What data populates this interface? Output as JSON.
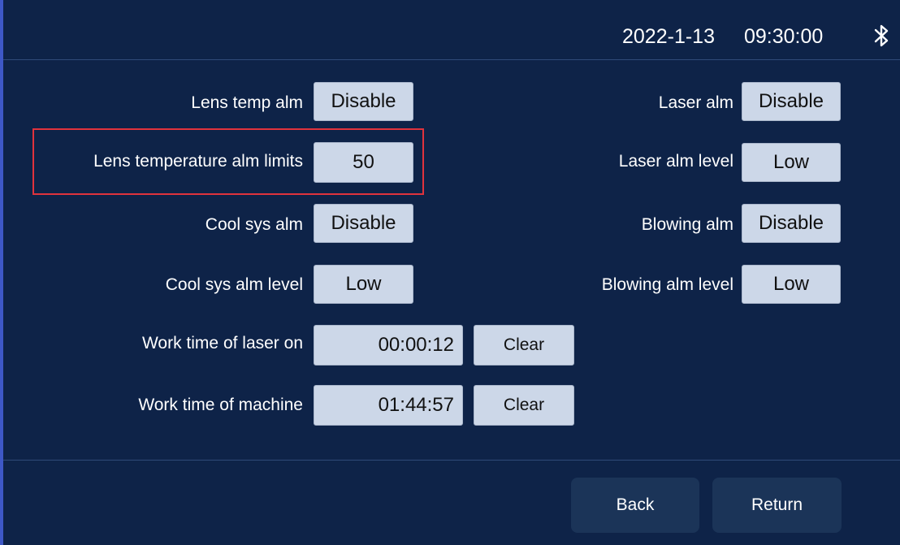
{
  "header": {
    "date": "2022-1-13",
    "time": "09:30:00",
    "status_icon": "bluetooth-icon"
  },
  "settings": {
    "lens_temp_alm": {
      "label": "Lens temp alm",
      "value": "Disable"
    },
    "lens_temp_alm_limits": {
      "label": "Lens temperature alm limits",
      "value": "50"
    },
    "cool_sys_alm": {
      "label": "Cool sys alm",
      "value": "Disable"
    },
    "cool_sys_alm_level": {
      "label": "Cool sys alm level",
      "value": "Low"
    },
    "laser_alm": {
      "label": "Laser alm",
      "value": "Disable"
    },
    "laser_alm_level": {
      "label": "Laser alm level",
      "value": "Low"
    },
    "blowing_alm": {
      "label": "Blowing alm",
      "value": "Disable"
    },
    "blowing_alm_level": {
      "label": "Blowing alm level",
      "value": "Low"
    },
    "work_time_laser_on": {
      "label": "Work time of laser on",
      "value": "00:00:12",
      "clear_label": "Clear"
    },
    "work_time_machine": {
      "label": "Work time of machine",
      "value": "01:44:57",
      "clear_label": "Clear"
    }
  },
  "footer": {
    "back_label": "Back",
    "return_label": "Return"
  },
  "colors": {
    "background": "#0e2348",
    "button_face": "#ccd7e8",
    "highlight": "#e0333d",
    "nav_button": "#1b3458",
    "left_edge": "#3e58c6"
  }
}
